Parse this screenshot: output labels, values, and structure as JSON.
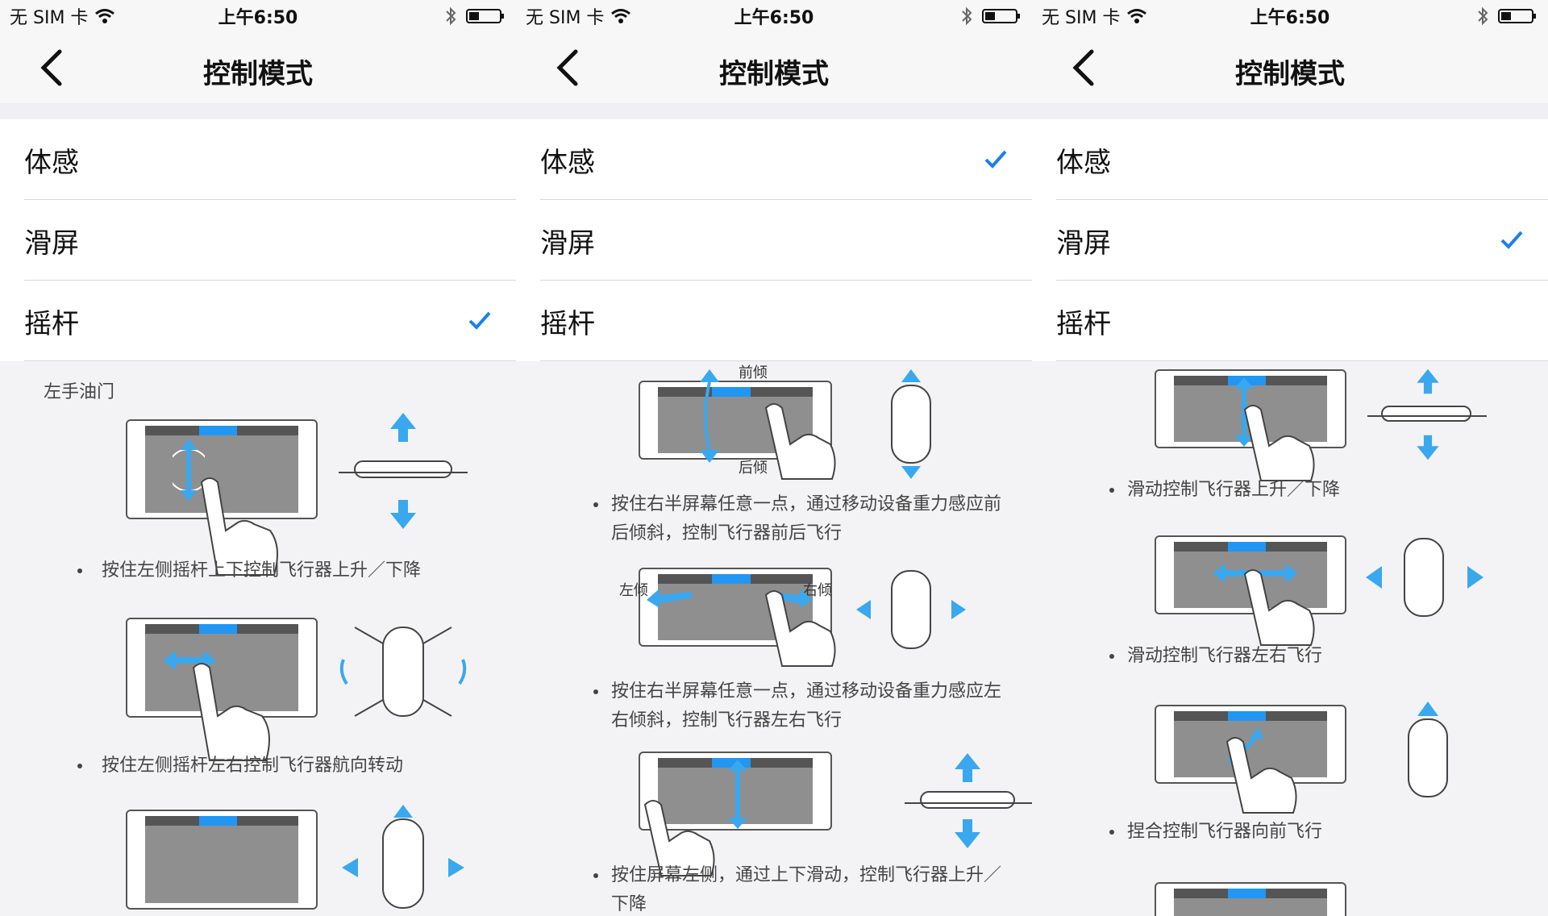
{
  "status": {
    "carrier": "无 SIM 卡",
    "time": "上午6:50",
    "wifi_icon": "wifi-icon",
    "bluetooth_icon": "bluetooth-icon",
    "battery_icon": "battery-icon"
  },
  "nav": {
    "title": "控制模式",
    "back_icon": "chevron-left-icon"
  },
  "panels": [
    {
      "items": [
        {
          "label": "体感",
          "checked": false
        },
        {
          "label": "滑屏",
          "checked": false
        },
        {
          "label": "摇杆",
          "checked": true
        }
      ],
      "section_title": "左手油门",
      "bullets": [
        "按住左侧摇杆上下控制飞行器上升／下降",
        "按住左侧摇杆左右控制飞行器航向转动"
      ]
    },
    {
      "items": [
        {
          "label": "体感",
          "checked": true
        },
        {
          "label": "滑屏",
          "checked": false
        },
        {
          "label": "摇杆",
          "checked": false
        }
      ],
      "fig_labels": {
        "forward": "前倾",
        "backward": "后倾",
        "left": "左倾",
        "right": "右倾"
      },
      "bullets": [
        "按住右半屏幕任意一点，通过移动设备重力感应前后倾斜，控制飞行器前后飞行",
        "按住右半屏幕任意一点，通过移动设备重力感应左右倾斜，控制飞行器左右飞行",
        "按住屏幕左侧，通过上下滑动，控制飞行器上升／下降"
      ]
    },
    {
      "items": [
        {
          "label": "体感",
          "checked": false
        },
        {
          "label": "滑屏",
          "checked": true
        },
        {
          "label": "摇杆",
          "checked": false
        }
      ],
      "bullets": [
        "滑动控制飞行器上升／下降",
        "滑动控制飞行器左右飞行",
        "捏合控制飞行器向前飞行"
      ]
    }
  ],
  "colors": {
    "accent": "#1a7ff0",
    "arrow": "#39a8ee",
    "separator": "#d7d7db",
    "background": "#f3f3f5"
  }
}
